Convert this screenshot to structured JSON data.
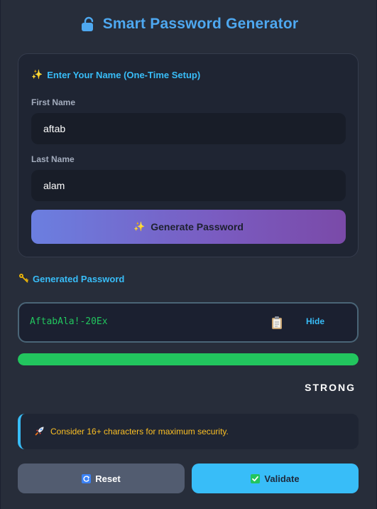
{
  "app": {
    "title": "Smart Password Generator",
    "accent_color": "#38bdf8",
    "title_color": "#4ea8f0",
    "header_icon": "lock-icon"
  },
  "setup": {
    "title": "Enter Your Name (One-Time Setup)",
    "title_icon": "sparkles-icon",
    "first_name_label": "First Name",
    "first_name_value": "aftab",
    "last_name_label": "Last Name",
    "last_name_value": "alam",
    "generate_label": "Generate Password",
    "generate_icon": "sparkles-icon"
  },
  "result": {
    "title": "Generated Password",
    "title_icon": "key-icon",
    "password": "AftabAla!-20Ex",
    "copy_icon": "clipboard-icon",
    "toggle_label": "Hide",
    "password_color": "#22c55e"
  },
  "strength": {
    "level": 1.0,
    "label": "STRONG",
    "color": "#22c55e"
  },
  "tip": {
    "icon": "rocket-icon",
    "text": "Consider 16+ characters for maximum security.",
    "color": "#fbbf24"
  },
  "actions": {
    "reset_label": "Reset",
    "reset_icon": "refresh-icon",
    "validate_label": "Validate",
    "validate_icon": "check-mark-icon"
  }
}
